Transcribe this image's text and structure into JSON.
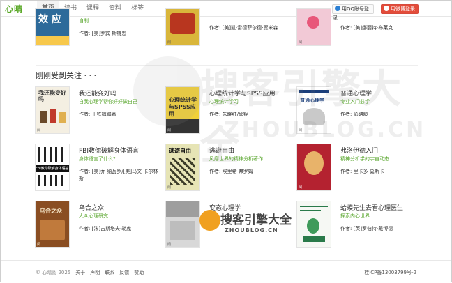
{
  "site": {
    "logo": "心晴"
  },
  "nav": [
    "首页",
    "读书",
    "课程",
    "资料",
    "标签"
  ],
  "login": {
    "qq": "用QQ账号登录",
    "weibo": "用微博登录"
  },
  "top_books": [
    {
      "subtitle": "自制",
      "author": "作者: [美]罗宾·斯特恩",
      "cover_bg": "#2d6a9a",
      "cover_text": "效 应"
    },
    {
      "subtitle": "",
      "author": "作者: [美]凯·雷德菲尔德·贾米森",
      "cover_bg": "#d9b63b",
      "cover_text": ""
    },
    {
      "subtitle": "",
      "author": "作者: [美]娜丽特·布莱克",
      "cover_bg": "#f2c9d6",
      "cover_text": ""
    }
  ],
  "section_title": "刚刚受到关注 · · ·",
  "books": [
    {
      "title": "我还能变好吗",
      "subtitle": "自我心理学帮你好好做自己",
      "author": "作者: 王铁梅编著",
      "cover_bg": "#f4efe2",
      "cover_text": "我还能变好吗",
      "cover_fg": "#333"
    },
    {
      "title": "心理统计学与SPSS应用",
      "subtitle": "心理统计学习",
      "author": "作者: 朱晓红/邱锦",
      "cover_bg": "#f1d039",
      "cover_text": "心理统计学与SPSS应用",
      "cover_fg": "#222"
    },
    {
      "title": "普通心理学",
      "subtitle": "专业入门必学",
      "author": "作者: 彭聃龄",
      "cover_bg": "#ffffff",
      "cover_text": "普通心理学",
      "cover_fg": "#1b3e7a"
    },
    {
      "title": "FBI教你破解身体语言",
      "subtitle": "身体语言了什么?",
      "author": "作者: [美]乔·纳瓦罗/[美]马文·卡尔林斯",
      "cover_bg": "#ffffff",
      "cover_text": "FBI教你破解身体语言",
      "cover_fg": "#111"
    },
    {
      "title": "逃避自由",
      "subtitle": "风靡世界的精神分析著作",
      "author": "作者: 埃里希·弗罗姆",
      "cover_bg": "#e6e4b5",
      "cover_text": "逃避自由",
      "cover_fg": "#111"
    },
    {
      "title": "弗洛伊德入门",
      "subtitle": "精神分析学的宇宙动态",
      "author": "作者: 里卡多·莫斯卡",
      "cover_bg": "#b42230",
      "cover_text": "",
      "cover_fg": "#fff"
    },
    {
      "title": "乌合之众",
      "subtitle": "大众心理研究",
      "author": "作者: [法]古斯塔夫·勒庞",
      "cover_bg": "#8a4e22",
      "cover_text": "乌合之众",
      "cover_fg": "#f5e6c8"
    },
    {
      "title": "变态心理学",
      "subtitle": "",
      "author": "",
      "cover_bg": "#d8d8d8",
      "cover_text": "",
      "cover_fg": "#333"
    },
    {
      "title": "蛤蟆先生去看心理医生",
      "subtitle": "探索内心世界",
      "author": "作者: [英]罗伯特·戴博德",
      "cover_bg": "#f6f8f4",
      "cover_text": "",
      "cover_fg": "#2a7a4a"
    }
  ],
  "cover_tag": "阅",
  "watermark": {
    "cn": "搜客引擎大全",
    "en": "ZHOUBLOG.CN"
  },
  "footer": {
    "copyright": "© 心晴阅 2025",
    "links": [
      "关于",
      "声明",
      "联系",
      "反馈",
      "赞助"
    ],
    "icp": "桂ICP备13003799号-2"
  }
}
